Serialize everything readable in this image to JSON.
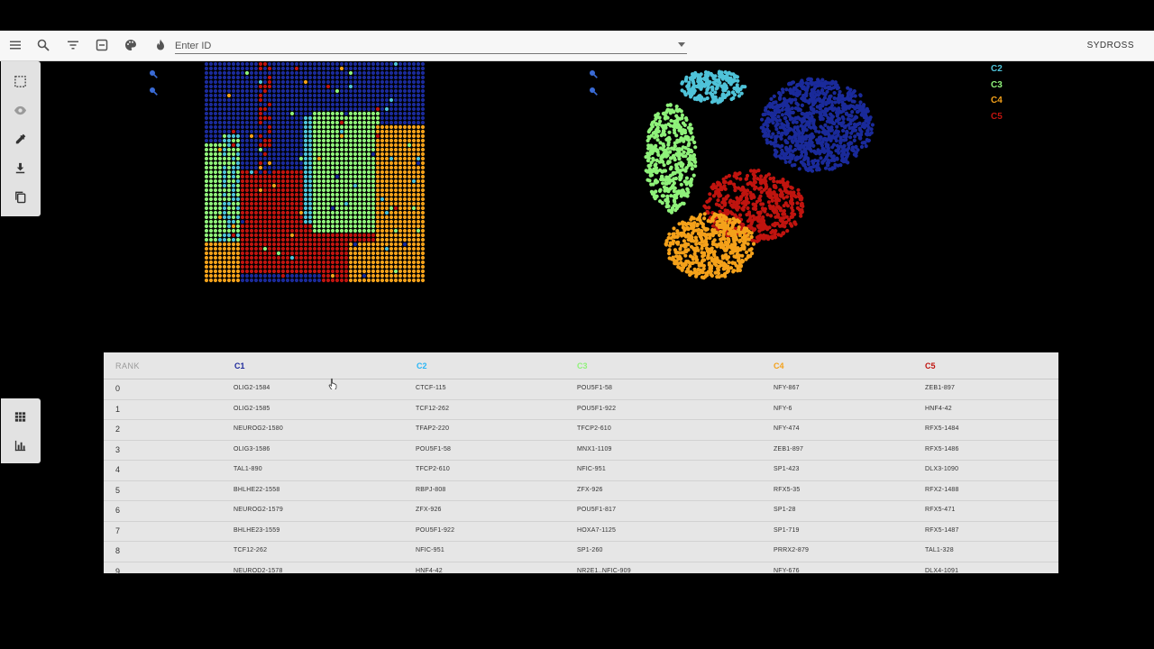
{
  "toolbar": {
    "id_placeholder": "Enter ID",
    "brand": "SYDROSS"
  },
  "legend": [
    {
      "label": "C2",
      "color": "#4fc3d9"
    },
    {
      "label": "C3",
      "color": "#8ff27a"
    },
    {
      "label": "C4",
      "color": "#f4a11a"
    },
    {
      "label": "C5",
      "color": "#c0140f"
    }
  ],
  "cluster_colors": {
    "C1": "#1a2a9a",
    "C2": "#4fc3d9",
    "C3": "#8ff27a",
    "C4": "#f4a11a",
    "C5": "#c0140f"
  },
  "table": {
    "headers": [
      {
        "label": "RANK",
        "color": "#999999"
      },
      {
        "label": "C1",
        "color": "#1e2a9c"
      },
      {
        "label": "C2",
        "color": "#29b6f6"
      },
      {
        "label": "C3",
        "color": "#8ff27a"
      },
      {
        "label": "C4",
        "color": "#f4a11a"
      },
      {
        "label": "C5",
        "color": "#c0140f"
      }
    ],
    "rows": [
      [
        "0",
        "OLIG2-1584",
        "CTCF-115",
        "POU5F1-58",
        "NFY-867",
        "ZEB1-897"
      ],
      [
        "1",
        "OLIG2-1585",
        "TCF12-262",
        "POU5F1-922",
        "NFY-6",
        "HNF4-42"
      ],
      [
        "2",
        "NEUROG2-1580",
        "TFAP2-220",
        "TFCP2-610",
        "NFY-474",
        "RFX5-1484"
      ],
      [
        "3",
        "OLIG3-1586",
        "POU5F1-58",
        "MNX1-1109",
        "ZEB1-897",
        "RFX5-1486"
      ],
      [
        "4",
        "TAL1-890",
        "TFCP2-610",
        "NFIC-951",
        "SP1-423",
        "DLX3-1090"
      ],
      [
        "5",
        "BHLHE22-1558",
        "RBPJ-808",
        "ZFX-926",
        "RFX5-35",
        "RFX2-1488"
      ],
      [
        "6",
        "NEUROG2-1579",
        "ZFX-926",
        "POU5F1-817",
        "SP1-28",
        "RFX5-471"
      ],
      [
        "7",
        "BHLHE23-1559",
        "POU5F1-922",
        "HOXA7-1125",
        "SP1-719",
        "RFX5-1487"
      ],
      [
        "8",
        "TCF12-262",
        "NFIC-951",
        "SP1-260",
        "PRRX2-879",
        "TAL1-328"
      ],
      [
        "9",
        "NEUROD2-1578",
        "HNF4-42",
        "NR2E1..NFIC-909",
        "NFY-676",
        "DLX4-1091"
      ]
    ]
  }
}
